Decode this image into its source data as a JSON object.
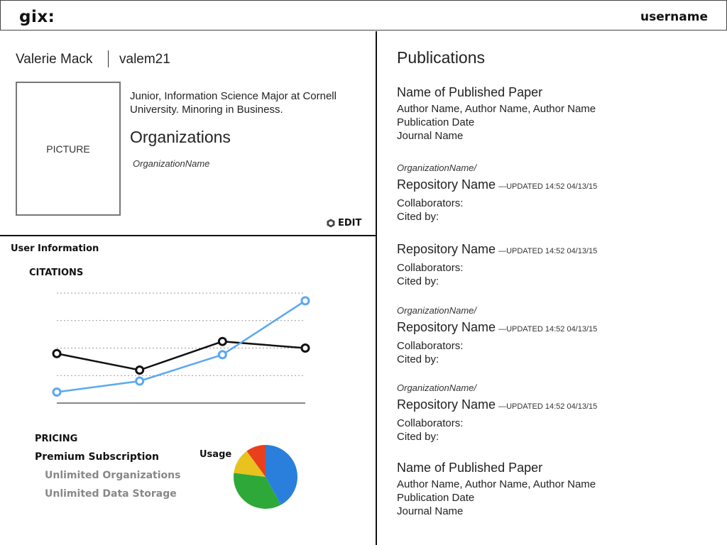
{
  "header": {
    "logo": "gix:",
    "username": "username"
  },
  "profile": {
    "name": "Valerie Mack",
    "handle": "valem21",
    "picture_label": "PICTURE",
    "bio": "Junior, Information Science Major at Cornell University. Minoring in Business.",
    "organizations_title": "Organizations",
    "organization_name": "OrganizationName",
    "edit_label": "EDIT"
  },
  "user_info": {
    "title": "User Information",
    "citations_title": "CITATIONS",
    "pricing_title": "PRICING",
    "plan": "Premium Subscription",
    "features": [
      "Unlimited Organizations",
      "Unlimited Data Storage"
    ],
    "usage_label": "Usage"
  },
  "chart_data": [
    {
      "type": "line",
      "title": "CITATIONS",
      "x": [
        1,
        2,
        3,
        4
      ],
      "series": [
        {
          "color": "#111111",
          "values": [
            0.45,
            0.3,
            0.56,
            0.5
          ]
        },
        {
          "color": "#5aa8f0",
          "values": [
            0.1,
            0.2,
            0.44,
            0.93
          ]
        }
      ],
      "ylim": [
        0,
        1
      ],
      "grid": true
    },
    {
      "type": "pie",
      "title": "Usage",
      "values": [
        42,
        35,
        13,
        10
      ],
      "colors": [
        "#2a7fdc",
        "#2fa83a",
        "#e8c21e",
        "#e8401c"
      ]
    }
  ],
  "publications": {
    "title": "Publications",
    "items": [
      {
        "kind": "paper",
        "title": "Name of Published Paper",
        "lines": [
          "Author Name, Author Name, Author Name",
          "Publication Date",
          "Journal Name"
        ]
      },
      {
        "kind": "repo",
        "org": "OrganizationName/",
        "title": "Repository Name",
        "updated": "—UPDATED 14:52 04/13/15",
        "lines": [
          "Collaborators:",
          "Cited by:"
        ]
      },
      {
        "kind": "repo",
        "org": "",
        "title": "Repository Name",
        "updated": "—UPDATED 14:52 04/13/15",
        "lines": [
          "Collaborators:",
          "Cited by:"
        ]
      },
      {
        "kind": "repo",
        "org": "OrganizationName/",
        "title": "Repository Name",
        "updated": "—UPDATED 14:52 04/13/15",
        "lines": [
          "Collaborators:",
          "Cited by:"
        ]
      },
      {
        "kind": "repo",
        "org": "OrganizationName/",
        "title": "Repository Name",
        "updated": "—UPDATED 14:52 04/13/15",
        "lines": [
          "Collaborators:",
          "Cited by:"
        ]
      },
      {
        "kind": "paper",
        "title": "Name of Published Paper",
        "lines": [
          "Author Name, Author Name, Author Name",
          "Publication Date",
          "Journal Name"
        ]
      }
    ]
  }
}
